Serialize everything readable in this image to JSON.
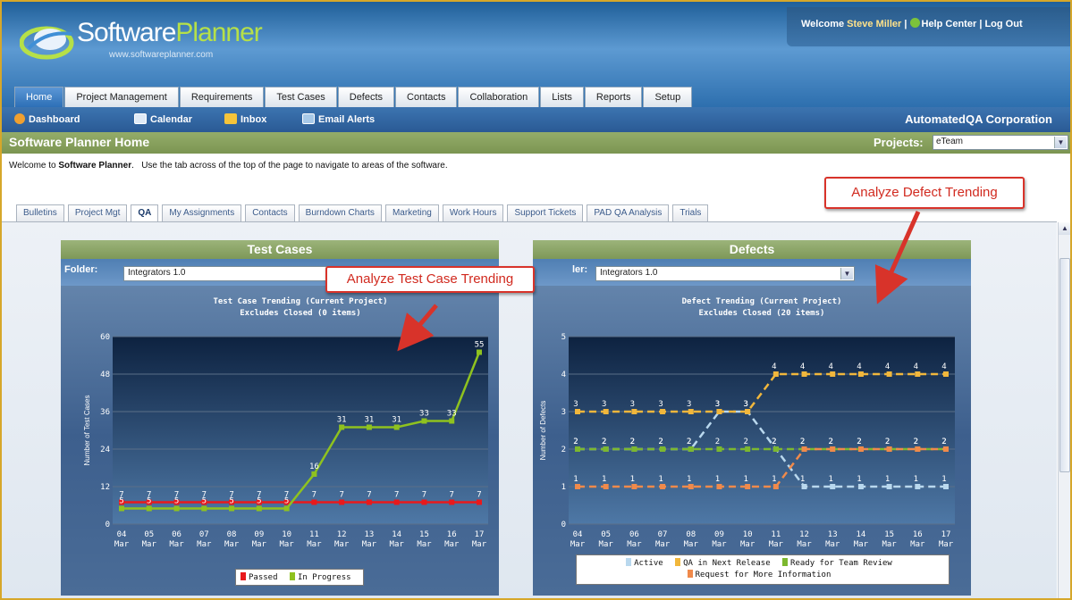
{
  "header": {
    "logo_word1": "Software",
    "logo_word2": "Planner",
    "logo_url": "www.softwareplanner.com",
    "welcome_prefix": "Welcome",
    "user_name": "Steve Miller",
    "help_label": "Help Center",
    "logout_label": "Log Out",
    "separator": "|"
  },
  "main_tabs": [
    "Home",
    "Project Management",
    "Requirements",
    "Test Cases",
    "Defects",
    "Contacts",
    "Collaboration",
    "Lists",
    "Reports",
    "Setup"
  ],
  "subnav": {
    "items": [
      "Dashboard",
      "Calendar",
      "Inbox",
      "Email Alerts"
    ],
    "company": "AutomatedQA Corporation"
  },
  "titlebar": {
    "title": "Software Planner Home",
    "projects_label": "Projects:",
    "project_value": "eTeam"
  },
  "welcome": {
    "prefix": "Welcome to ",
    "app": "Software Planner",
    "suffix": ".   Use the tab across of the top of the page to navigate to areas of the software."
  },
  "inner_tabs": [
    "Bulletins",
    "Project Mgt",
    "QA",
    "My Assignments",
    "Contacts",
    "Burndown Charts",
    "Marketing",
    "Work Hours",
    "Support Tickets",
    "PAD QA Analysis",
    "Trials"
  ],
  "test_panel": {
    "title": "Test Cases",
    "folder_label": "Folder:",
    "folder_value": "Integrators 1.0"
  },
  "defect_panel": {
    "title": "Defects",
    "folder_label": "ler:",
    "folder_value": "Integrators 1.0"
  },
  "callouts": {
    "test": "Analyze Test Case Trending",
    "defect": "Analyze Defect Trending"
  },
  "colors": {
    "passed": "#e8191c",
    "in_progress": "#8fc21f",
    "active": "#b9d8ee",
    "qa_next": "#f1b73c",
    "ready_review": "#7cb82f",
    "request_info": "#f08a4b"
  },
  "chart_data": [
    {
      "type": "line",
      "title": "Test Case Trending (Current Project)",
      "subtitle": "Excludes Closed (0 items)",
      "xlabel": "",
      "ylabel": "Number of Test Cases",
      "ylim": [
        0,
        60
      ],
      "yticks": [
        0,
        12,
        24,
        36,
        48,
        60
      ],
      "categories": [
        "04 Mar",
        "05 Mar",
        "06 Mar",
        "07 Mar",
        "08 Mar",
        "09 Mar",
        "10 Mar",
        "11 Mar",
        "12 Mar",
        "13 Mar",
        "14 Mar",
        "15 Mar",
        "16 Mar",
        "17 Mar"
      ],
      "series": [
        {
          "name": "Passed",
          "values": [
            7,
            7,
            7,
            7,
            7,
            7,
            7,
            7,
            7,
            7,
            7,
            7,
            7,
            7
          ]
        },
        {
          "name": "In Progress",
          "values": [
            5,
            5,
            5,
            5,
            5,
            5,
            5,
            16,
            31,
            31,
            31,
            33,
            33,
            55
          ]
        }
      ],
      "grid": true,
      "legend": "bottom"
    },
    {
      "type": "line",
      "title": "Defect Trending (Current Project)",
      "subtitle": "Excludes Closed (20 items)",
      "xlabel": "",
      "ylabel": "Number of Defects",
      "ylim": [
        0,
        5
      ],
      "yticks": [
        0,
        1,
        2,
        3,
        4,
        5
      ],
      "categories": [
        "04 Mar",
        "05 Mar",
        "06 Mar",
        "07 Mar",
        "08 Mar",
        "09 Mar",
        "10 Mar",
        "11 Mar",
        "12 Mar",
        "13 Mar",
        "14 Mar",
        "15 Mar",
        "16 Mar",
        "17 Mar"
      ],
      "series": [
        {
          "name": "Active",
          "values": [
            2,
            2,
            2,
            2,
            2,
            3,
            3,
            2,
            1,
            1,
            1,
            1,
            1,
            1
          ]
        },
        {
          "name": "QA in Next Release",
          "values": [
            3,
            3,
            3,
            3,
            3,
            3,
            3,
            4,
            4,
            4,
            4,
            4,
            4,
            4
          ]
        },
        {
          "name": "Ready for Team Review",
          "values": [
            2,
            2,
            2,
            2,
            2,
            2,
            2,
            2,
            2,
            2,
            2,
            2,
            2,
            2
          ]
        },
        {
          "name": "Request for More Information",
          "values": [
            1,
            1,
            1,
            1,
            1,
            1,
            1,
            1,
            2,
            2,
            2,
            2,
            2,
            2
          ]
        }
      ],
      "grid": true,
      "legend": "bottom"
    }
  ]
}
